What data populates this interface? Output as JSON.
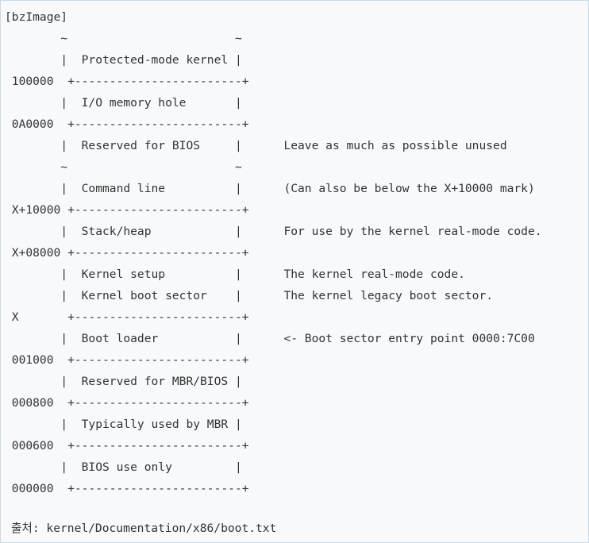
{
  "code": {
    "lines": [
      "[bzImage]",
      "        ~                        ~",
      "        |  Protected-mode kernel |",
      " 100000  +------------------------+",
      "        |  I/O memory hole       |",
      " 0A0000  +------------------------+",
      "        |  Reserved for BIOS     |      Leave as much as possible unused",
      "        ~                        ~",
      "        |  Command line          |      (Can also be below the X+10000 mark)",
      " X+10000 +------------------------+",
      "        |  Stack/heap            |      For use by the kernel real-mode code.",
      " X+08000 +------------------------+",
      "        |  Kernel setup          |      The kernel real-mode code.",
      "        |  Kernel boot sector    |      The kernel legacy boot sector.",
      " X       +------------------------+",
      "        |  Boot loader           |      <- Boot sector entry point 0000:7C00",
      " 001000  +------------------------+",
      "        |  Reserved for MBR/BIOS |",
      " 000800  +------------------------+",
      "        |  Typically used by MBR |",
      " 000600  +------------------------+",
      "        |  BIOS use only         |",
      " 000000  +------------------------+"
    ]
  },
  "caption": {
    "text": "출처: kernel/Documentation/x86/boot.txt"
  }
}
